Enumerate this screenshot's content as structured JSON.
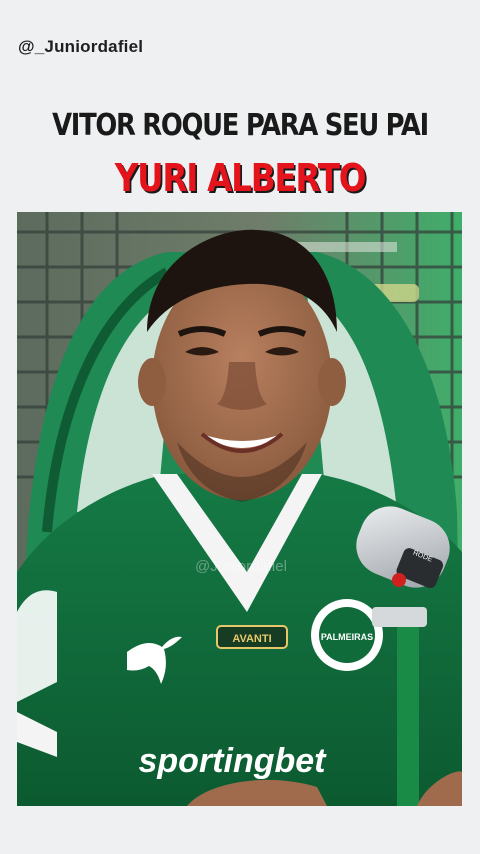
{
  "post": {
    "handle": "@_Juniordafiel",
    "headline_line1": "VITOR ROQUE PARA SEU PAI",
    "headline_line2": "YURI ALBERTO"
  },
  "video": {
    "watermark": "@Juniordafiel",
    "jersey_sponsor": "sportingbet",
    "jersey_brand": "PUMA",
    "jersey_patch": "AVANTI",
    "club_crest_text": "PALMEIRAS",
    "mic_label": "RODE"
  },
  "colors": {
    "headline_dark": "#1a1a1a",
    "headline_red": "#e3141c",
    "jersey_green": "#0f6b3a",
    "chair_green": "#1f8a53",
    "background": "#eef0f2"
  }
}
